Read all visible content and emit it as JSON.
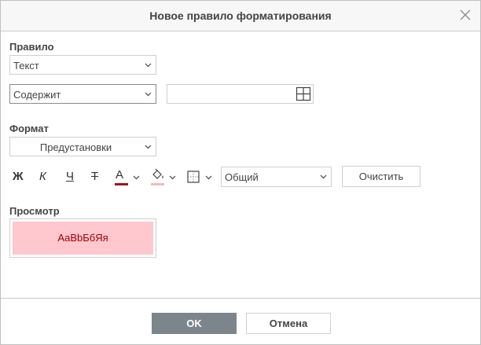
{
  "dialog": {
    "title": "Новое правило форматирования",
    "close_icon": "close-icon"
  },
  "rule": {
    "label": "Правило",
    "type_value": "Текст",
    "condition_value": "Содержит",
    "text_value": "",
    "range_icon": "table-grid-icon"
  },
  "format": {
    "label": "Формат",
    "presets_value": "Предустановки",
    "bold_label": "Ж",
    "italic_label": "К",
    "underline_label": "Ч",
    "strike_label": "Т",
    "font_color_label": "А",
    "font_color": "#a0151b",
    "fill_color": "#f4b8c0",
    "number_format_value": "Общий",
    "clear_label": "Очистить"
  },
  "preview": {
    "label": "Просмотр",
    "sample_text": "АаВbБбЯя",
    "text_color": "#9c0006",
    "background": "#ffc7ce"
  },
  "footer": {
    "ok_label": "OK",
    "cancel_label": "Отмена"
  }
}
